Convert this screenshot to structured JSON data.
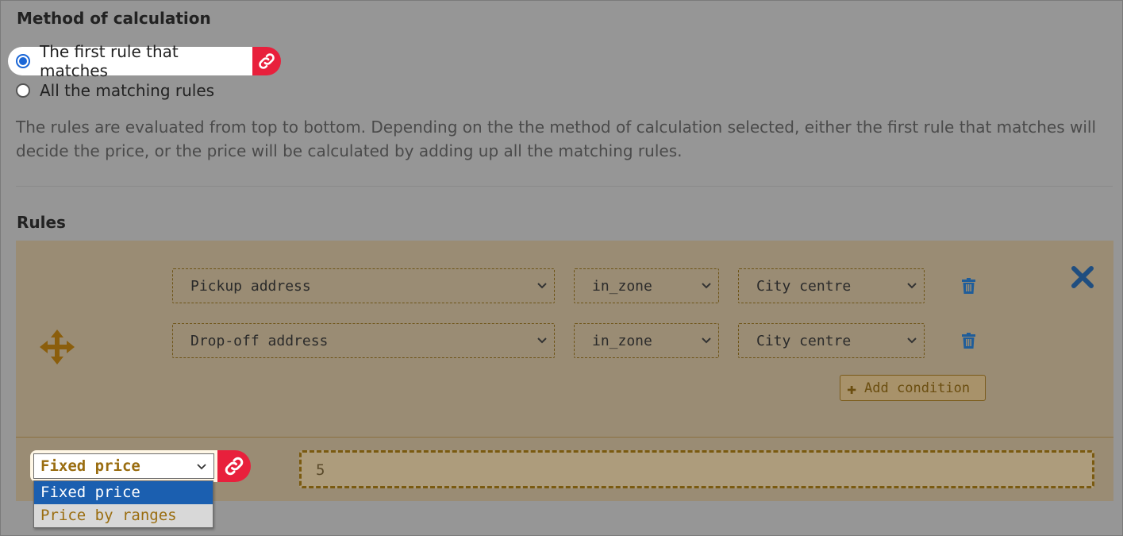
{
  "method": {
    "title": "Method of calculation",
    "options": [
      {
        "label": "The first rule that matches",
        "checked": true
      },
      {
        "label": "All the matching rules",
        "checked": false
      }
    ],
    "description": "The rules are evaluated from top to bottom. Depending on the the method of calculation selected, either the first rule that matches will decide the price, or the price will be calculated by adding up all the matching rules."
  },
  "rules": {
    "title": "Rules",
    "conditions": [
      {
        "field": "Pickup address",
        "operator": "in_zone",
        "value": "City centre"
      },
      {
        "field": "Drop-off address",
        "operator": "in_zone",
        "value": "City centre"
      }
    ],
    "add_condition_label": "Add condition",
    "price_type": {
      "selected": "Fixed price",
      "options": [
        "Fixed price",
        "Price by ranges"
      ]
    },
    "price_value": "5"
  },
  "icons": {
    "link": "link-icon",
    "move": "move-arrows-icon",
    "close": "close-x-icon",
    "trash": "trash-icon",
    "chevron": "chevron-down-icon",
    "plus": "plus-icon"
  },
  "colors": {
    "link_badge": "#e8203c",
    "radio_accent": "#1a66d6",
    "rule_accent": "#8b5e0c",
    "close_icon": "#1f4e80",
    "trash_icon": "#1f5d9a",
    "dropdown_selected": "#1b5fb0"
  }
}
